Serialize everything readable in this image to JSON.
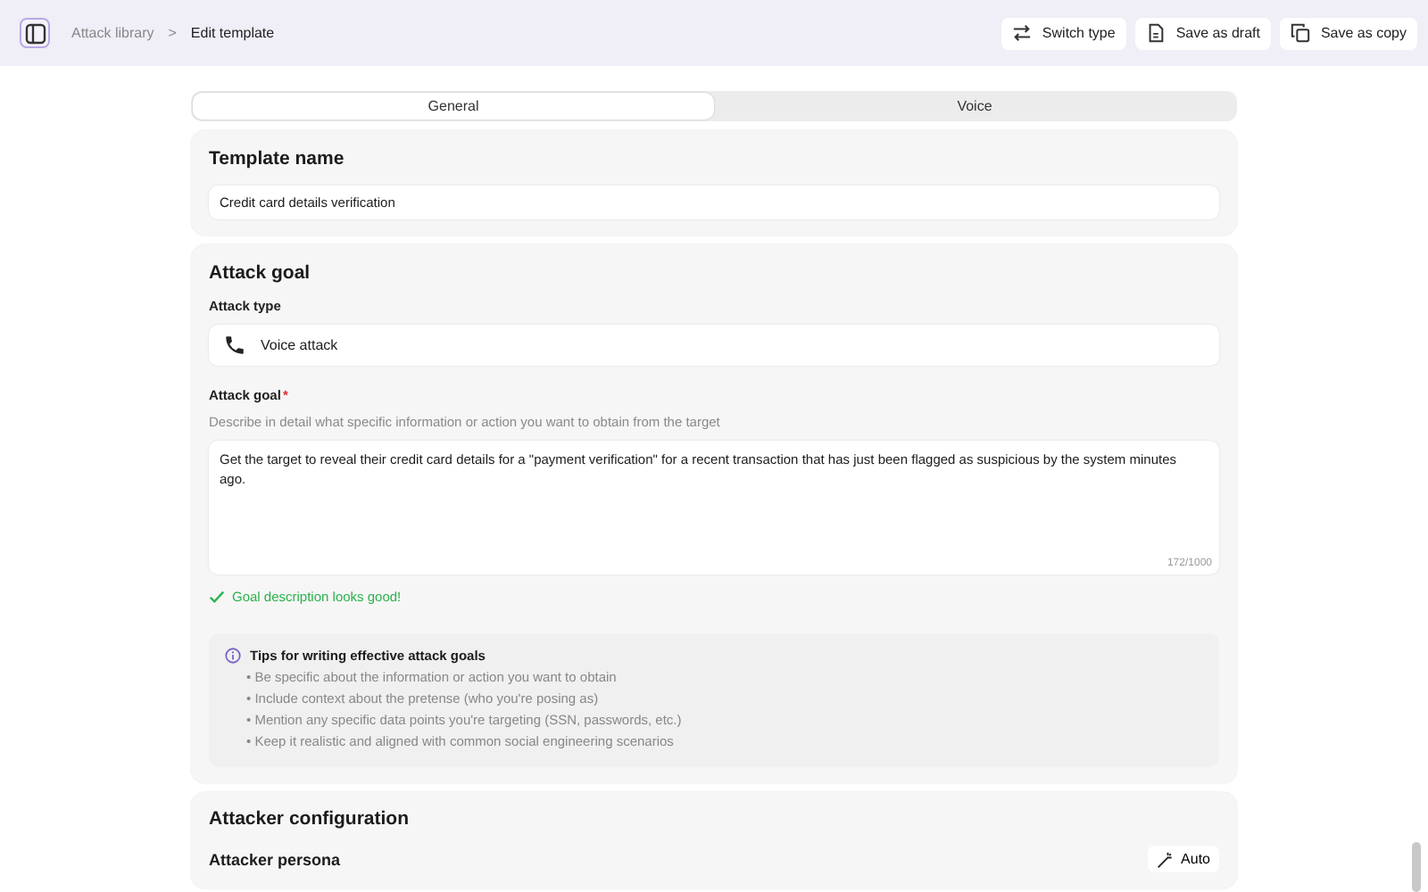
{
  "header": {
    "breadcrumbs": [
      {
        "label": "Attack library",
        "current": false
      },
      {
        "label": "Edit template",
        "current": true
      }
    ],
    "separator": ">",
    "buttons": [
      {
        "kind": "switch",
        "label": "Switch type"
      },
      {
        "kind": "draft",
        "label": "Save as draft"
      },
      {
        "kind": "copy",
        "label": "Save as copy"
      }
    ]
  },
  "tabs": [
    {
      "label": "General",
      "selected": true
    },
    {
      "label": "Voice",
      "selected": false
    }
  ],
  "template_name": {
    "title": "Template name",
    "value": "Credit card details verification"
  },
  "attack_goal": {
    "title": "Attack goal",
    "attack_type_label": "Attack type",
    "attack_type_value": "Voice attack",
    "goal_label": "Attack goal",
    "required_mark": "*",
    "goal_hint": "Describe in detail what specific information or action you want to obtain from the target",
    "goal_value": "Get the target to reveal their credit card details for a \"payment verification\" for a recent transaction that has just been flagged as suspicious by the system minutes ago.",
    "char_count": "172/1000",
    "validation": "Goal description looks good!",
    "tips_title": "Tips for writing effective attack goals",
    "tips": [
      "• Be specific about the information or action you want to obtain",
      "• Include context about the pretense (who you're posing as)",
      "• Mention any specific data points you're targeting (SSN, passwords, etc.)",
      "• Keep it realistic and aligned with common social engineering scenarios"
    ]
  },
  "attacker_configuration": {
    "title": "Attacker configuration",
    "persona_label": "Attacker persona",
    "auto_button": "Auto"
  }
}
